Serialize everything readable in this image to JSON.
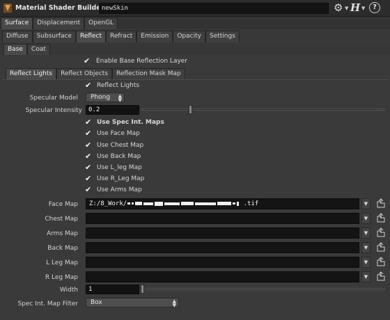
{
  "title": {
    "app_name": "Material Shader Builder",
    "node_name": "newSkin",
    "gear_icon": "gear-icon",
    "help_label": "?"
  },
  "top_tabs": [
    "Surface",
    "Displacement",
    "OpenGL"
  ],
  "surface_tabs": [
    "Diffuse",
    "Subsurface",
    "Reflect",
    "Refract",
    "Emission",
    "Opacity",
    "Settings"
  ],
  "reflect_tabs": [
    "Base",
    "Coat"
  ],
  "base": {
    "enable_base_reflection_layer": "Enable Base Reflection Layer"
  },
  "layer_tabs": [
    "Reflect Lights",
    "Reflect Objects",
    "Reflection Mask Map"
  ],
  "reflect_lights": {
    "reflect_lights_label": "Reflect Lights",
    "specular_model_label": "Specular Model",
    "specular_model_value": "Phong",
    "specular_intensity_label": "Specular Intensity",
    "specular_intensity_value": "0.2",
    "specular_intensity_level": 0.2,
    "use_spec_int_maps_label": "Use Spec Int. Maps",
    "use_face_map": "Use Face Map",
    "use_chest_map": "Use Chest Map",
    "use_back_map": "Use Back Map",
    "use_lleg_map": "Use L_leg Map",
    "use_rleg_map": "Use R_Leg Map",
    "use_arms_map": "Use Arms Map",
    "face_map_label": "Face Map",
    "face_map_value_start": "Z:/8_Work/",
    "face_map_value_end": ".tif",
    "chest_map_label": "Chest Map",
    "arms_map_label": "Arms Map",
    "back_map_label": "Back Map",
    "lleg_map_label": "L Leg Map",
    "rleg_map_label": "R Leg Map",
    "width_label": "Width",
    "width_value": "1",
    "width_level": 0.1,
    "filter_label": "Spec Int. Map Filter",
    "filter_value": "Box"
  }
}
